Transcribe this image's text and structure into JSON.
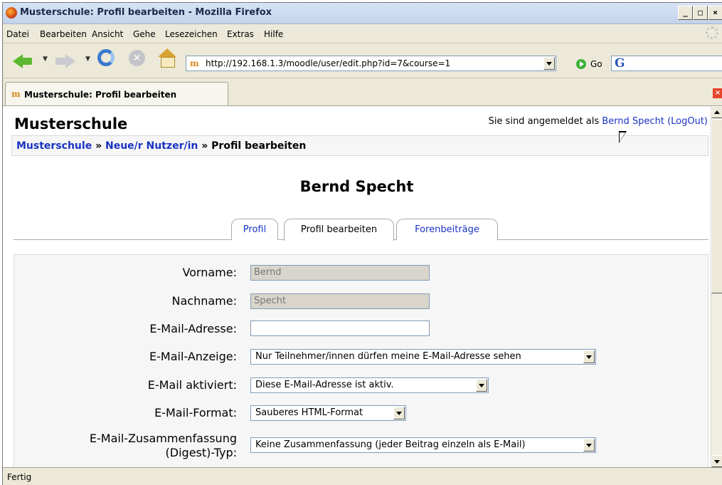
{
  "window": {
    "title": "Musterschule: Profil bearbeiten - Mozilla Firefox",
    "controls": [
      "_",
      "□",
      "×"
    ]
  },
  "menu": [
    "Datei",
    "Bearbeiten",
    "Ansicht",
    "Gehe",
    "Lesezeichen",
    "Extras",
    "Hilfe"
  ],
  "toolbar": {
    "url": "http://192.168.1.3/moodle/user/edit.php?id=7&course=1",
    "go_label": "Go",
    "site_icon": "m",
    "search_icon": "G"
  },
  "browser_tab": {
    "label": "Musterschule: Profil bearbeiten",
    "close": "×"
  },
  "page": {
    "site_title": "Musterschule",
    "login_prefix": "Sie sind angemeldet als",
    "login_user": "Bernd Specht",
    "logout": "(LogOut)",
    "breadcrumb": {
      "root": "Musterschule",
      "sep1": "»",
      "middle": "Neue/r Nutzer/in",
      "sep2": "»",
      "current": "Profil bearbeiten"
    },
    "user_name": "Bernd Specht",
    "tabs": [
      "Profil",
      "Profil bearbeiten",
      "Forenbeiträge"
    ],
    "form": {
      "vorname_label": "Vorname:",
      "vorname_value": "Bernd",
      "nachname_label": "Nachname:",
      "nachname_value": "Specht",
      "email_label": "E-Mail-Adresse:",
      "email_value": "",
      "email_anzeige_label": "E-Mail-Anzeige:",
      "email_anzeige_value": "Nur Teilnehmer/innen dürfen meine E-Mail-Adresse sehen",
      "email_aktiviert_label": "E-Mail aktiviert:",
      "email_aktiviert_value": "Diese E-Mail-Adresse ist aktiv.",
      "email_format_label": "E-Mail-Format:",
      "email_format_value": "Sauberes HTML-Format",
      "digest_label_1": "E-Mail-Zusammenfassung",
      "digest_label_2": "(Digest)-Typ:",
      "digest_value": "Keine Zusammenfassung (jeder Beitrag einzeln als E-Mail)"
    }
  },
  "status": "Fertig",
  "colors": {
    "link": "#1a33c4",
    "chrome": "#ece9d8"
  }
}
